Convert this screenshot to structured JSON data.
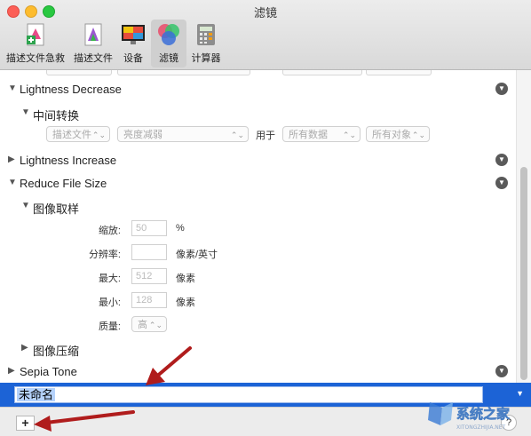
{
  "window": {
    "title": "滤镜"
  },
  "toolbar": {
    "items": [
      {
        "label": "描述文件急救",
        "icon": "profile-first-aid-icon"
      },
      {
        "label": "描述文件",
        "icon": "profiles-icon"
      },
      {
        "label": "设备",
        "icon": "devices-icon"
      },
      {
        "label": "滤镜",
        "icon": "filters-icon",
        "selected": true
      },
      {
        "label": "计算器",
        "icon": "calculator-icon"
      }
    ]
  },
  "filters": [
    {
      "name": "Lightness Decrease",
      "expanded": true,
      "sub": {
        "title": "中间转换",
        "apply": {
          "type": "描述文件",
          "method": "亮度减弱",
          "for_label": "用于",
          "data": "所有数据",
          "objects": "所有对象"
        }
      }
    },
    {
      "name": "Lightness Increase",
      "expanded": false
    },
    {
      "name": "Reduce File Size",
      "expanded": true,
      "sub": {
        "title": "图像取样",
        "fields": {
          "scale": {
            "label": "缩放:",
            "value": "50",
            "unit": "%"
          },
          "resolution": {
            "label": "分辨率:",
            "value": "",
            "unit": "像素/英寸"
          },
          "max": {
            "label": "最大:",
            "value": "512",
            "unit": "像素"
          },
          "min": {
            "label": "最小:",
            "value": "128",
            "unit": "像素"
          },
          "quality": {
            "label": "质量:",
            "value": "高"
          }
        },
        "compression_title": "图像压缩"
      }
    },
    {
      "name": "Sepia Tone",
      "expanded": false
    }
  ],
  "new_filter": {
    "name": "未命名"
  },
  "bottom": {
    "add_label": "+",
    "help_label": "?"
  },
  "watermark": {
    "text": "系统之家"
  },
  "colors": {
    "selection": "#1c63d6",
    "arrow": "#b01c1c"
  }
}
